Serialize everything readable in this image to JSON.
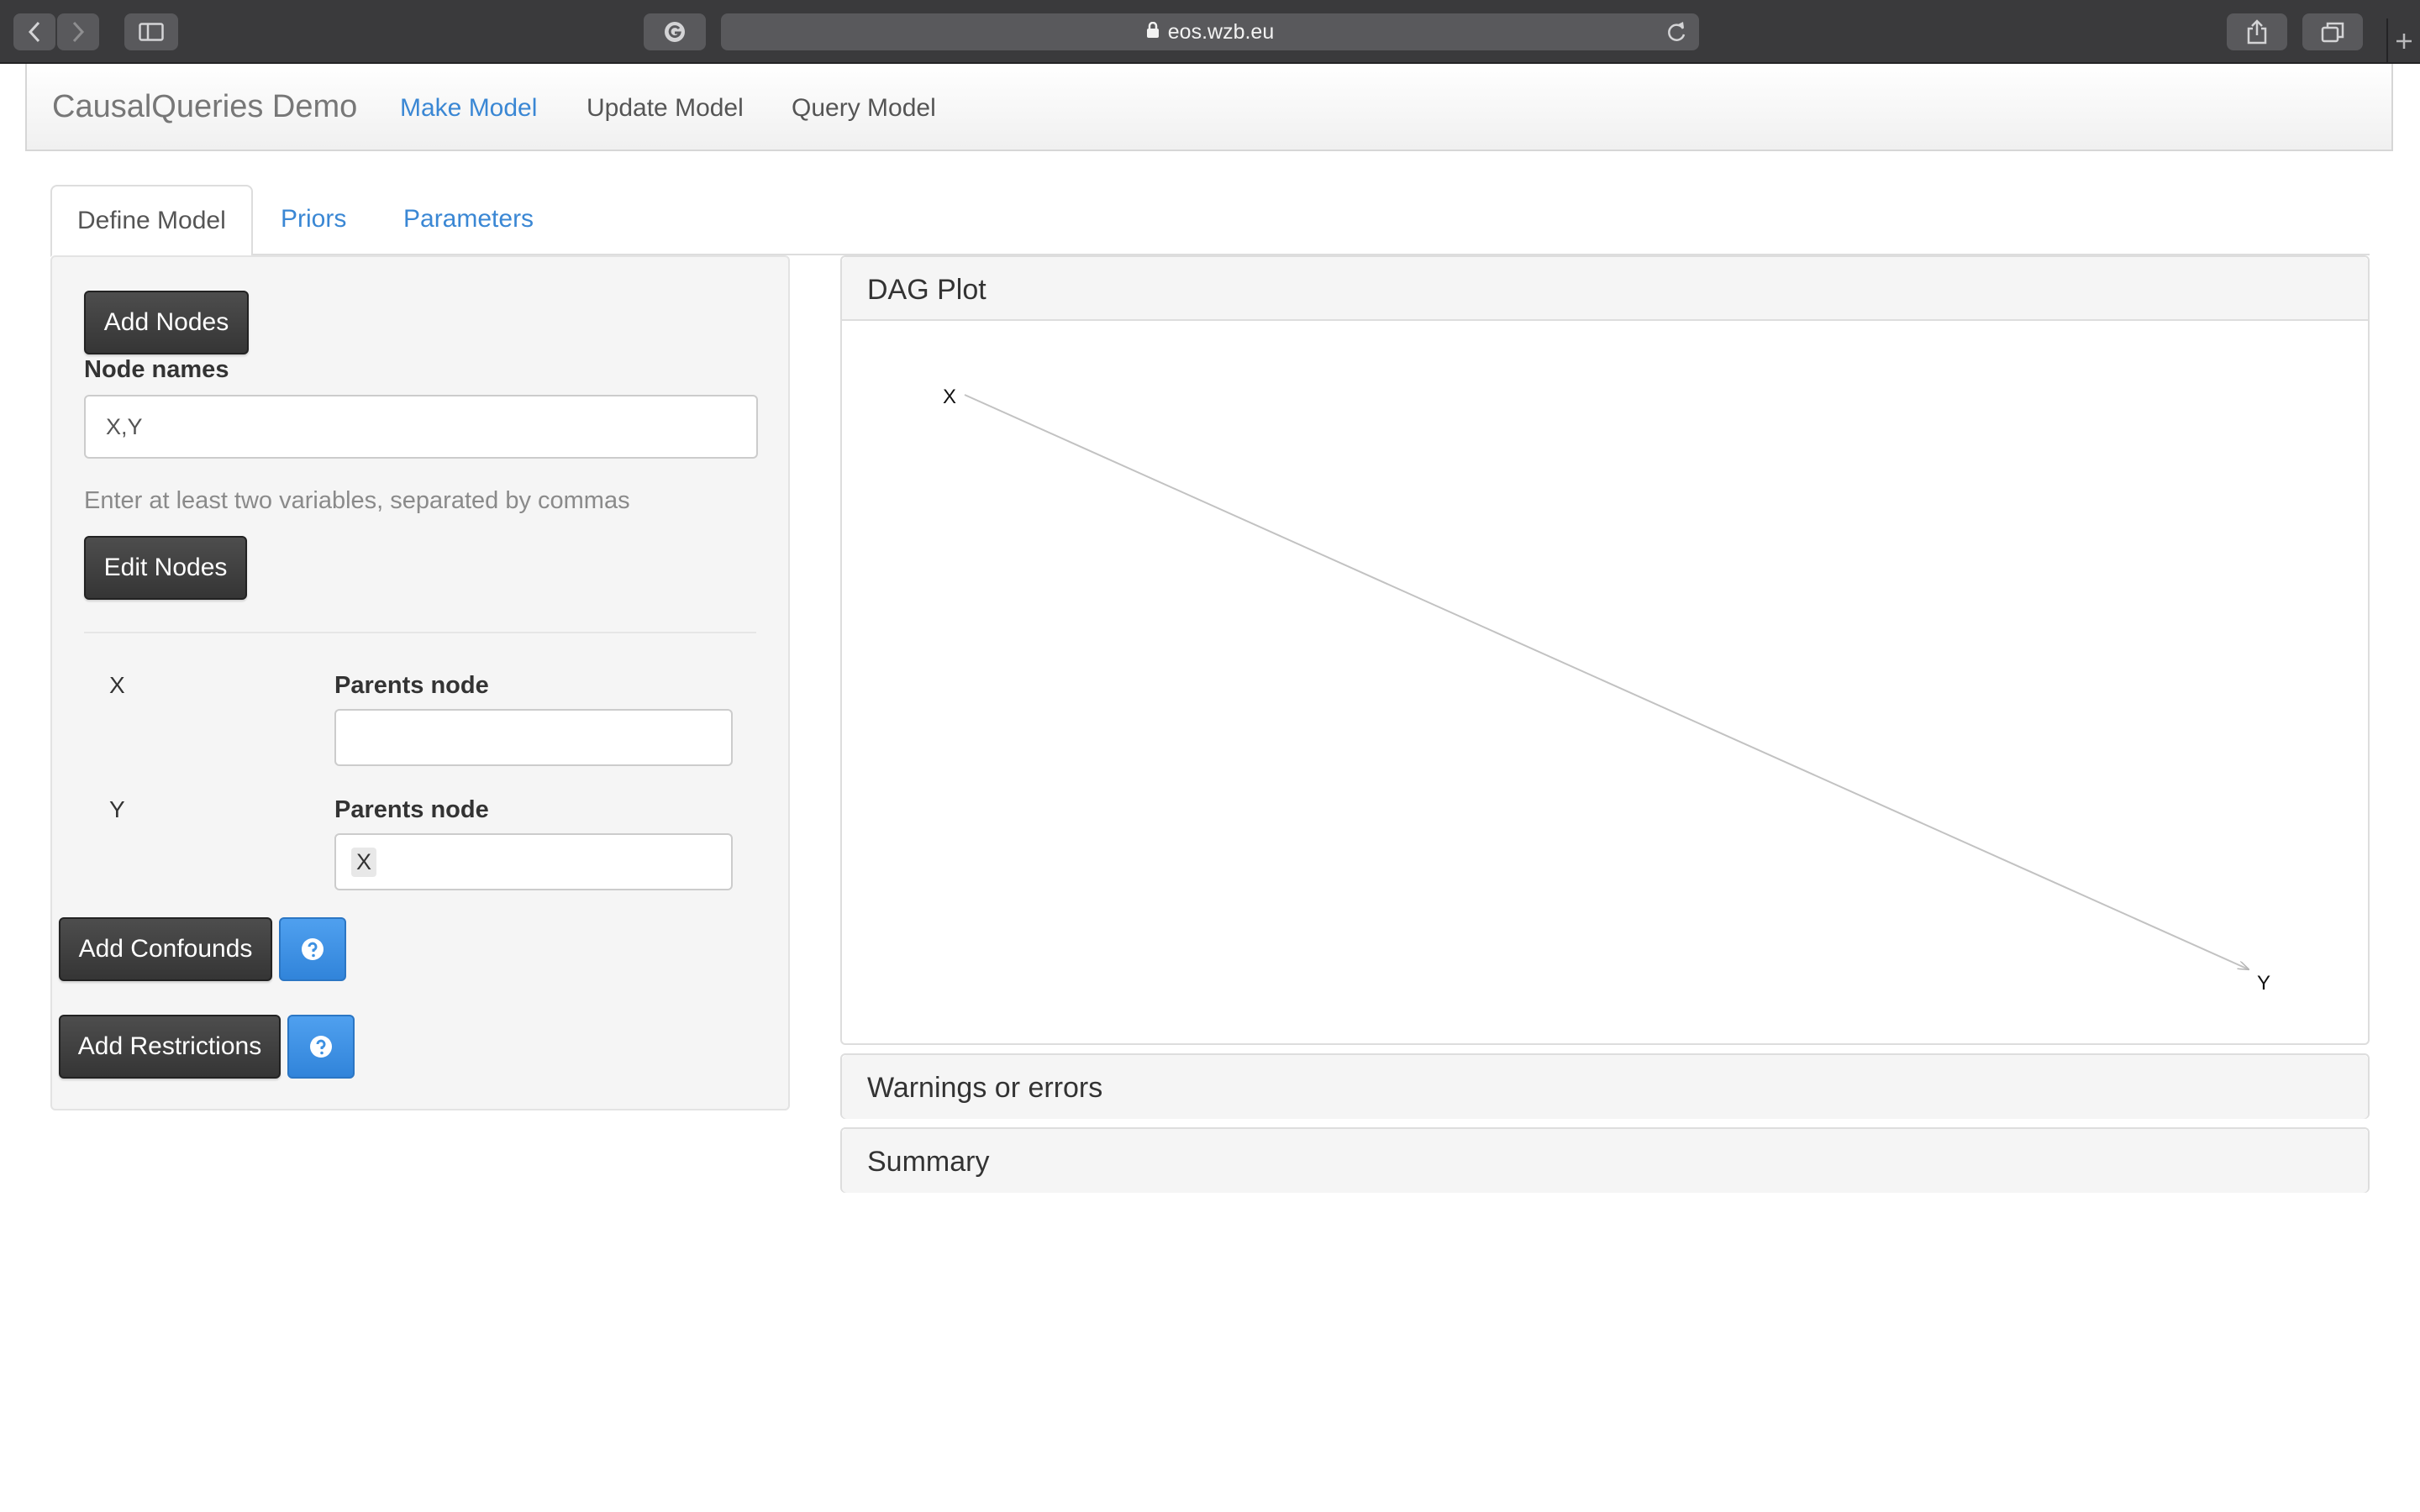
{
  "browser": {
    "url": "eos.wzb.eu"
  },
  "navbar": {
    "brand": "CausalQueries Demo",
    "links": [
      "Make Model",
      "Update Model",
      "Query Model"
    ]
  },
  "tabs": [
    "Define Model",
    "Priors",
    "Parameters"
  ],
  "sidebar": {
    "add_nodes_label": "Add Nodes",
    "node_names_label": "Node names",
    "node_names_value": "X,Y",
    "node_names_help": "Enter at least two variables, separated by commas",
    "edit_nodes_label": "Edit Nodes",
    "nodes": [
      {
        "name": "X",
        "parents_label": "Parents node",
        "parents": ""
      },
      {
        "name": "Y",
        "parents_label": "Parents node",
        "parents": "X"
      }
    ],
    "add_confounds_label": "Add Confounds",
    "add_restrictions_label": "Add Restrictions",
    "help_icon": "question-circle-icon"
  },
  "dag_panel": {
    "title": "DAG Plot",
    "nodes": [
      "X",
      "Y"
    ],
    "edges": [
      [
        "X",
        "Y"
      ]
    ]
  },
  "warnings_panel": {
    "title": "Warnings or errors"
  },
  "summary_panel": {
    "title": "Summary"
  },
  "colors": {
    "accent": "#3a87d4",
    "button_dark": "#3d3d3d",
    "button_blue": "#3d91e2"
  }
}
